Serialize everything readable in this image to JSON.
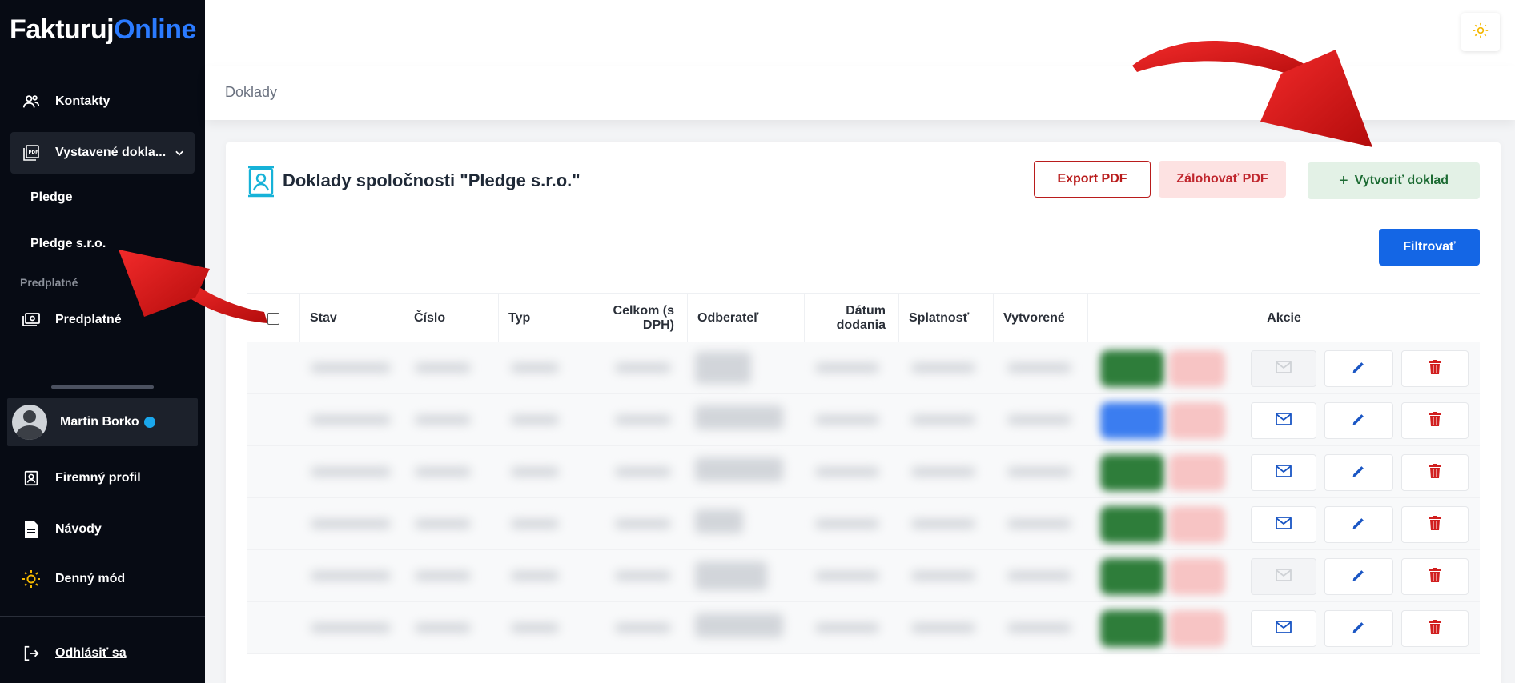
{
  "sidebar": {
    "logo_part1": "Fakturuj",
    "logo_part2": "Online",
    "items": [
      {
        "label": "Kontakty",
        "icon": "users-icon"
      },
      {
        "label": "Vystavené dokla...",
        "icon": "pdf-icon"
      },
      {
        "label": "Predplatné",
        "icon": "money-icon"
      },
      {
        "label": "Firemný profil",
        "icon": "id-card-icon"
      },
      {
        "label": "Návody",
        "icon": "document-icon"
      },
      {
        "label": "Denný mód",
        "icon": "sun-icon"
      },
      {
        "label": "Odhlásiť sa",
        "icon": "logout-icon"
      }
    ],
    "sub_items": [
      "Pledge",
      "Pledge s.r.o."
    ],
    "section_label": "Predplatné",
    "user_name": "Martin Borko"
  },
  "breadcrumb": "Doklady",
  "card": {
    "title": "Doklady spoločnosti \"Pledge s.r.o.\"",
    "export_label": "Export PDF",
    "zaloha_label": "Zálohovať PDF",
    "create_label": "Vytvoriť doklad",
    "filter_label": "Filtrovať"
  },
  "table": {
    "columns": [
      "Stav",
      "Číslo",
      "Typ",
      "Celkom (s DPH)",
      "Odberateľ",
      "Dátum dodania",
      "Splatnosť",
      "Vytvorené",
      "Akcie"
    ]
  },
  "colors": {
    "sidebar_bg": "#070b14",
    "brand_blue": "#2b7bff",
    "primary_button": "#1466e5",
    "danger": "#b91c1c",
    "success": "#1c6b33",
    "arrow_red": "#e0191b"
  }
}
